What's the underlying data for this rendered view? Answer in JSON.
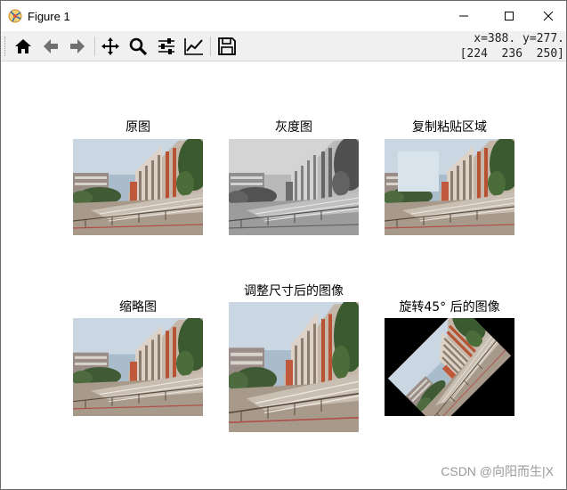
{
  "window": {
    "title": "Figure 1",
    "icons": {
      "app": "figure-app-icon",
      "minimize": "minimize-icon",
      "maximize": "maximize-icon",
      "close": "close-icon"
    }
  },
  "toolbar": {
    "tools": [
      "home-icon",
      "back-arrow-icon",
      "forward-arrow-icon",
      "pan-move-icon",
      "zoom-magnifier-icon",
      "configure-subplots-icon",
      "edit-axes-icon",
      "save-floppy-icon"
    ],
    "coord_line1": "x=388. y=277.",
    "coord_line2": "[224  236  250]"
  },
  "panels": {
    "p1": {
      "title": "原图"
    },
    "p2": {
      "title": "灰度图"
    },
    "p3": {
      "title": "复制粘贴区域"
    },
    "p4": {
      "title": "缩略图"
    },
    "p5": {
      "title": "调整尺寸后的图像"
    },
    "p6": {
      "title": "旋转45° 后的图像"
    }
  },
  "watermark": "CSDN @向阳而生|X"
}
